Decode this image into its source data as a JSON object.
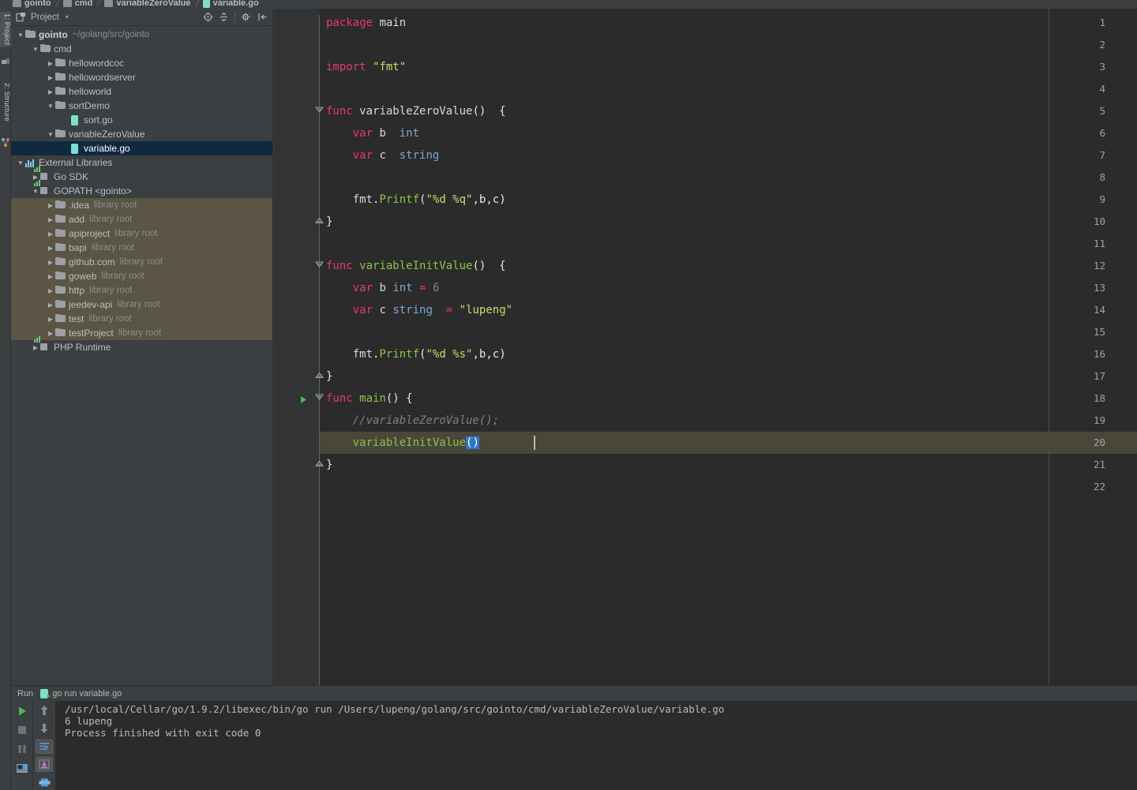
{
  "breadcrumb": {
    "items": [
      {
        "label": "gointo",
        "icon": "folder-icon",
        "type": "folder"
      },
      {
        "label": "cmd",
        "icon": "folder-icon",
        "type": "folder"
      },
      {
        "label": "variableZeroValue",
        "icon": "folder-icon",
        "type": "folder"
      },
      {
        "label": "variable.go",
        "icon": "go-file-icon",
        "type": "file"
      }
    ],
    "separator": "/"
  },
  "left_strip": {
    "tabs": [
      {
        "label": "1: Project",
        "icon": "project-tool-icon",
        "active": true
      },
      {
        "label": "2: Structure",
        "icon": "structure-tool-icon",
        "active": false
      }
    ]
  },
  "project_panel": {
    "title": "Project",
    "title_caret": "▾",
    "header_icon": "project-view-icon",
    "tools": [
      {
        "name": "locate-icon",
        "title": "Scroll from Source"
      },
      {
        "name": "collapse-all-icon",
        "title": "Collapse All"
      },
      {
        "name": "gear-icon",
        "title": "Settings"
      },
      {
        "name": "hide-panel-icon",
        "title": "Hide"
      }
    ],
    "tree": [
      {
        "depth": 0,
        "arrow": "down",
        "icon": "folder-icon",
        "label": "gointo",
        "bold": true,
        "sub": "~/golang/src/gointo",
        "selected": false,
        "lib": false
      },
      {
        "depth": 1,
        "arrow": "down",
        "icon": "folder-icon",
        "label": "cmd",
        "bold": false,
        "sub": "",
        "selected": false,
        "lib": false
      },
      {
        "depth": 2,
        "arrow": "right",
        "icon": "folder-icon",
        "label": "hellowordcoc",
        "bold": false,
        "sub": "",
        "selected": false,
        "lib": false
      },
      {
        "depth": 2,
        "arrow": "right",
        "icon": "folder-icon",
        "label": "hellowordserver",
        "bold": false,
        "sub": "",
        "selected": false,
        "lib": false
      },
      {
        "depth": 2,
        "arrow": "right",
        "icon": "folder-icon",
        "label": "helloworld",
        "bold": false,
        "sub": "",
        "selected": false,
        "lib": false
      },
      {
        "depth": 2,
        "arrow": "down",
        "icon": "folder-icon",
        "label": "sortDemo",
        "bold": false,
        "sub": "",
        "selected": false,
        "lib": false
      },
      {
        "depth": 3,
        "arrow": "none",
        "icon": "go-file-icon",
        "label": "sort.go",
        "bold": false,
        "sub": "",
        "selected": false,
        "lib": false
      },
      {
        "depth": 2,
        "arrow": "down",
        "icon": "folder-icon",
        "label": "variableZeroValue",
        "bold": false,
        "sub": "",
        "selected": false,
        "lib": false
      },
      {
        "depth": 3,
        "arrow": "none",
        "icon": "go-file-icon",
        "label": "variable.go",
        "bold": false,
        "sub": "",
        "selected": true,
        "lib": false
      },
      {
        "depth": 0,
        "arrow": "down",
        "icon": "libraries-icon",
        "label": "External Libraries",
        "bold": false,
        "sub": "",
        "selected": false,
        "lib": false
      },
      {
        "depth": 1,
        "arrow": "right",
        "icon": "sdk-icon",
        "label": "Go SDK",
        "bold": false,
        "sub": "",
        "selected": false,
        "lib": false
      },
      {
        "depth": 1,
        "arrow": "down",
        "icon": "sdk-icon",
        "label": "GOPATH <gointo>",
        "bold": false,
        "sub": "",
        "selected": false,
        "lib": false
      },
      {
        "depth": 2,
        "arrow": "right",
        "icon": "folder-icon",
        "label": ".idea",
        "bold": false,
        "sub": "library root",
        "selected": false,
        "lib": true
      },
      {
        "depth": 2,
        "arrow": "right",
        "icon": "folder-icon",
        "label": "add",
        "bold": false,
        "sub": "library root",
        "selected": false,
        "lib": true
      },
      {
        "depth": 2,
        "arrow": "right",
        "icon": "folder-icon",
        "label": "apiproject",
        "bold": false,
        "sub": "library root",
        "selected": false,
        "lib": true
      },
      {
        "depth": 2,
        "arrow": "right",
        "icon": "folder-icon",
        "label": "bapi",
        "bold": false,
        "sub": "library root",
        "selected": false,
        "lib": true
      },
      {
        "depth": 2,
        "arrow": "right",
        "icon": "folder-icon",
        "label": "github.com",
        "bold": false,
        "sub": "library root",
        "selected": false,
        "lib": true
      },
      {
        "depth": 2,
        "arrow": "right",
        "icon": "folder-icon",
        "label": "goweb",
        "bold": false,
        "sub": "library root",
        "selected": false,
        "lib": true
      },
      {
        "depth": 2,
        "arrow": "right",
        "icon": "folder-icon",
        "label": "http",
        "bold": false,
        "sub": "library root",
        "selected": false,
        "lib": true
      },
      {
        "depth": 2,
        "arrow": "right",
        "icon": "folder-icon",
        "label": "jeedev-api",
        "bold": false,
        "sub": "library root",
        "selected": false,
        "lib": true
      },
      {
        "depth": 2,
        "arrow": "right",
        "icon": "folder-icon",
        "label": "test",
        "bold": false,
        "sub": "library root",
        "selected": false,
        "lib": true
      },
      {
        "depth": 2,
        "arrow": "right",
        "icon": "folder-icon",
        "label": "testProject",
        "bold": false,
        "sub": "library root",
        "selected": false,
        "lib": true
      },
      {
        "depth": 1,
        "arrow": "right",
        "icon": "sdk-icon",
        "label": "PHP Runtime",
        "bold": false,
        "sub": "",
        "selected": false,
        "lib": false
      }
    ]
  },
  "editor": {
    "total_lines": 22,
    "caret_line": 20,
    "lines": [
      {
        "n": 1,
        "tokens": [
          {
            "t": "package",
            "c": "kwp"
          },
          {
            "t": " ",
            "c": "plain"
          },
          {
            "t": "main",
            "c": "plain"
          }
        ]
      },
      {
        "n": 2,
        "tokens": []
      },
      {
        "n": 3,
        "tokens": [
          {
            "t": "import",
            "c": "kwp"
          },
          {
            "t": " ",
            "c": "plain"
          },
          {
            "t": "\"fmt\"",
            "c": "str"
          }
        ]
      },
      {
        "n": 4,
        "tokens": []
      },
      {
        "n": 5,
        "tokens": [
          {
            "t": "func",
            "c": "kwp"
          },
          {
            "t": " ",
            "c": "plain"
          },
          {
            "t": "variableZeroValue",
            "c": "plain"
          },
          {
            "t": "()",
            "c": "punc"
          },
          {
            "t": "  {",
            "c": "punc"
          }
        ]
      },
      {
        "n": 6,
        "tokens": [
          {
            "t": "    ",
            "c": "plain"
          },
          {
            "t": "var",
            "c": "kwp"
          },
          {
            "t": " ",
            "c": "plain"
          },
          {
            "t": "b",
            "c": "plain"
          },
          {
            "t": "  ",
            "c": "plain"
          },
          {
            "t": "int",
            "c": "typ"
          }
        ]
      },
      {
        "n": 7,
        "tokens": [
          {
            "t": "    ",
            "c": "plain"
          },
          {
            "t": "var",
            "c": "kwp"
          },
          {
            "t": " ",
            "c": "plain"
          },
          {
            "t": "c",
            "c": "plain"
          },
          {
            "t": "  ",
            "c": "plain"
          },
          {
            "t": "string",
            "c": "typ"
          }
        ]
      },
      {
        "n": 8,
        "tokens": []
      },
      {
        "n": 9,
        "tokens": [
          {
            "t": "    ",
            "c": "plain"
          },
          {
            "t": "fmt",
            "c": "plain"
          },
          {
            "t": ".",
            "c": "punc"
          },
          {
            "t": "Printf",
            "c": "fn"
          },
          {
            "t": "(",
            "c": "punc"
          },
          {
            "t": "\"%d %q\"",
            "c": "str"
          },
          {
            "t": ",b,c)",
            "c": "punc"
          }
        ]
      },
      {
        "n": 10,
        "tokens": [
          {
            "t": "}",
            "c": "punc"
          }
        ]
      },
      {
        "n": 11,
        "tokens": []
      },
      {
        "n": 12,
        "tokens": [
          {
            "t": "func",
            "c": "kwp"
          },
          {
            "t": " ",
            "c": "plain"
          },
          {
            "t": "variableInitValue",
            "c": "fn"
          },
          {
            "t": "()",
            "c": "punc"
          },
          {
            "t": "  {",
            "c": "punc"
          }
        ]
      },
      {
        "n": 13,
        "tokens": [
          {
            "t": "    ",
            "c": "plain"
          },
          {
            "t": "var",
            "c": "kwp"
          },
          {
            "t": " ",
            "c": "plain"
          },
          {
            "t": "b",
            "c": "plain"
          },
          {
            "t": " ",
            "c": "plain"
          },
          {
            "t": "int",
            "c": "typ"
          },
          {
            "t": " ",
            "c": "plain"
          },
          {
            "t": "=",
            "c": "op"
          },
          {
            "t": " ",
            "c": "plain"
          },
          {
            "t": "6",
            "c": "num"
          }
        ]
      },
      {
        "n": 14,
        "tokens": [
          {
            "t": "    ",
            "c": "plain"
          },
          {
            "t": "var",
            "c": "kwp"
          },
          {
            "t": " ",
            "c": "plain"
          },
          {
            "t": "c",
            "c": "plain"
          },
          {
            "t": " ",
            "c": "plain"
          },
          {
            "t": "string",
            "c": "typ"
          },
          {
            "t": "  ",
            "c": "plain"
          },
          {
            "t": "=",
            "c": "op"
          },
          {
            "t": " ",
            "c": "plain"
          },
          {
            "t": "\"lupeng\"",
            "c": "str"
          }
        ]
      },
      {
        "n": 15,
        "tokens": []
      },
      {
        "n": 16,
        "tokens": [
          {
            "t": "    ",
            "c": "plain"
          },
          {
            "t": "fmt",
            "c": "plain"
          },
          {
            "t": ".",
            "c": "punc"
          },
          {
            "t": "Printf",
            "c": "fn"
          },
          {
            "t": "(",
            "c": "punc"
          },
          {
            "t": "\"%d %s\"",
            "c": "str"
          },
          {
            "t": ",b,c)",
            "c": "punc"
          }
        ]
      },
      {
        "n": 17,
        "tokens": [
          {
            "t": "}",
            "c": "punc"
          }
        ]
      },
      {
        "n": 18,
        "tokens": [
          {
            "t": "func",
            "c": "kwp"
          },
          {
            "t": " ",
            "c": "plain"
          },
          {
            "t": "main",
            "c": "fn"
          },
          {
            "t": "()",
            "c": "punc"
          },
          {
            "t": " {",
            "c": "punc"
          }
        ]
      },
      {
        "n": 19,
        "tokens": [
          {
            "t": "    //variableZeroValue();",
            "c": "cmt"
          }
        ]
      },
      {
        "n": 20,
        "tokens": [
          {
            "t": "    ",
            "c": "plain"
          },
          {
            "t": "variableInitValue",
            "c": "fn"
          },
          {
            "t": "()",
            "c": "sel"
          }
        ]
      },
      {
        "n": 21,
        "tokens": [
          {
            "t": "}",
            "c": "punc"
          }
        ]
      },
      {
        "n": 22,
        "tokens": []
      }
    ],
    "fold_lines": [
      5,
      10,
      12,
      17,
      18,
      21
    ],
    "run_marker_line": 18
  },
  "run_window": {
    "tab_label": "Run",
    "config_name": "go run variable.go",
    "config_icon": "go-run-config-icon",
    "left_buttons": [
      {
        "name": "rerun-button",
        "icon": "play-icon"
      },
      {
        "name": "stop-button",
        "icon": "stop-icon"
      },
      {
        "name": "pause-button",
        "icon": "pause-icon"
      },
      {
        "name": "dump-threads-button",
        "icon": "camera-icon"
      }
    ],
    "right_buttons": [
      {
        "name": "scroll-up-button",
        "icon": "arrow-up-icon"
      },
      {
        "name": "scroll-down-button",
        "icon": "arrow-down-icon"
      },
      {
        "name": "soft-wrap-button",
        "icon": "soft-wrap-icon"
      },
      {
        "name": "scroll-to-end-button",
        "icon": "scroll-end-icon"
      },
      {
        "name": "print-button",
        "icon": "print-icon"
      }
    ],
    "console_lines": [
      "/usr/local/Cellar/go/1.9.2/libexec/bin/go run /Users/lupeng/golang/src/gointo/cmd/variableZeroValue/variable.go",
      "6 lupeng",
      "Process finished with exit code 0"
    ]
  },
  "colors": {
    "editor_bg": "#2b2b2b",
    "gutter_bg": "#313335",
    "panel_bg": "#3c3f41",
    "selection_blue": "#2f79c4",
    "tree_selection": "#10293f",
    "library_highlight": "#5a5544",
    "caret_row": "#4a4639",
    "keyword_pink": "#e8376f",
    "function_green": "#8bc34a",
    "string_yellow": "#d3d76a",
    "type_blue": "#7fa8d4",
    "number_purple": "#9876aa",
    "comment_gray": "#808080",
    "go_file_teal": "#7ddfd0"
  }
}
